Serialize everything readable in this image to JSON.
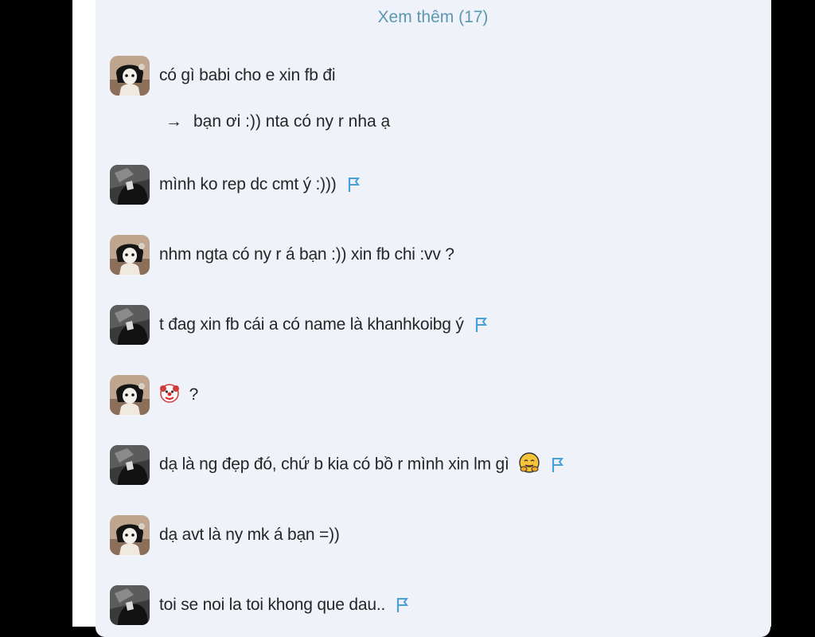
{
  "thread": {
    "more_link": "Xem thêm (17)",
    "reply_arrow": "→",
    "reply_text": "bạn ơi :)) nta có ny r nha ạ",
    "question_mark": "?",
    "accent_color": "#5a98b0",
    "flag_color": "#4a9fd8"
  },
  "comments": [
    {
      "text": "có gì babi cho e xin fb đi",
      "avatar": "girl-avatar"
    },
    {
      "text": "mình ko rep dc cmt ý :)))",
      "avatar": "dark-avatar"
    },
    {
      "text": "nhm ngta có ny r á bạn :)) xin fb chi :vv ?",
      "avatar": "girl-avatar"
    },
    {
      "text": "t đag xin fb cái a có name là khanhkoibg ý",
      "avatar": "dark-avatar"
    },
    {
      "text": "",
      "avatar": "girl-avatar"
    },
    {
      "text": "dạ là ng đẹp đó, chứ b kia có bồ r mình xin lm gì",
      "avatar": "dark-avatar"
    },
    {
      "text": "dạ avt là ny mk á bạn =))",
      "avatar": "girl-avatar"
    },
    {
      "text": "toi se noi la toi khong que dau..",
      "avatar": "dark-avatar"
    }
  ]
}
